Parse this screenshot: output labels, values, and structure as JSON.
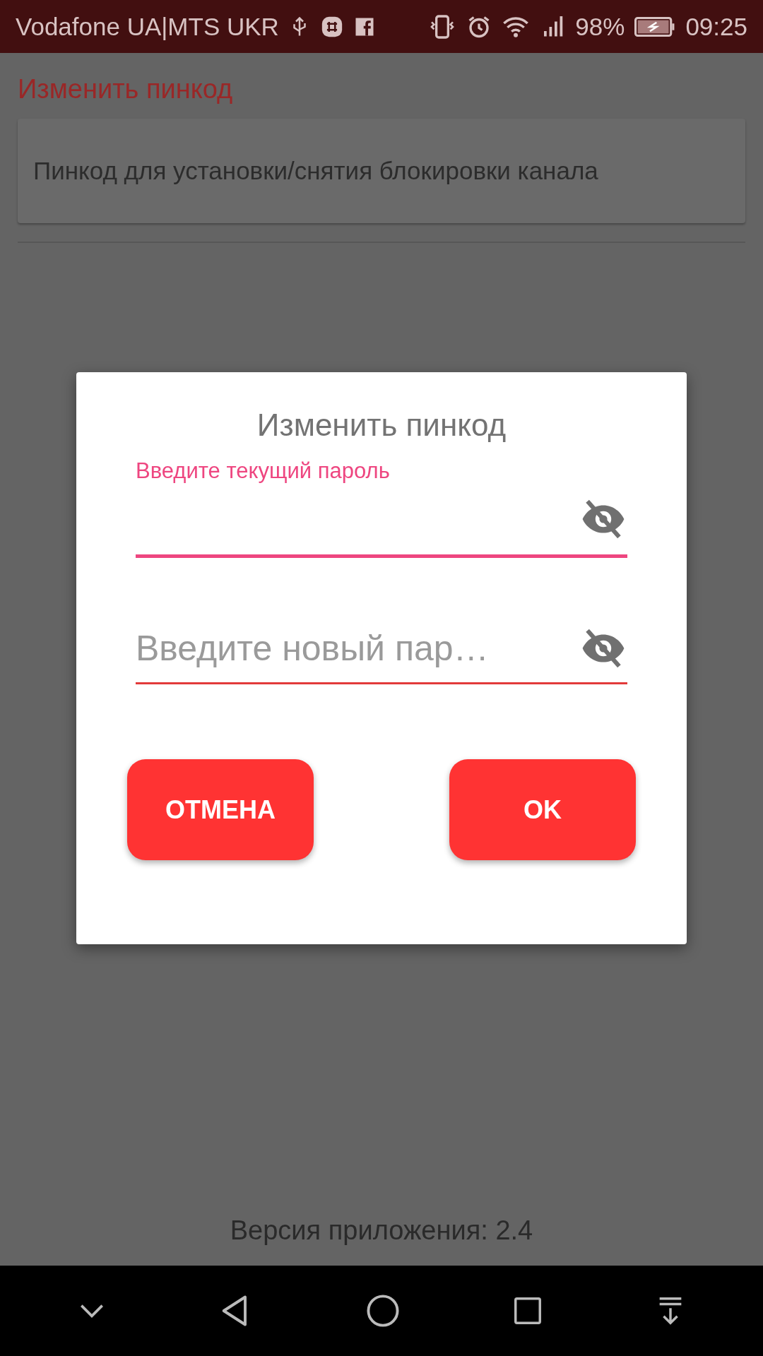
{
  "status_bar": {
    "carrier": "Vodafone UA|MTS UKR",
    "battery": "98%",
    "time": "09:25"
  },
  "header": {
    "title": "Изменить пинкод"
  },
  "settings": [
    {
      "label": "Пинкод для установки/снятия блокировки канала"
    }
  ],
  "dialog": {
    "title": "Изменить пинкод",
    "fields": [
      {
        "label": "Введите текущий пароль",
        "focused": true
      },
      {
        "placeholder": "Введите новый пар…",
        "focused": false
      }
    ],
    "buttons": [
      "ОТМЕНА",
      "OK"
    ]
  },
  "footer": {
    "version": "Версия приложения: 2.4"
  }
}
